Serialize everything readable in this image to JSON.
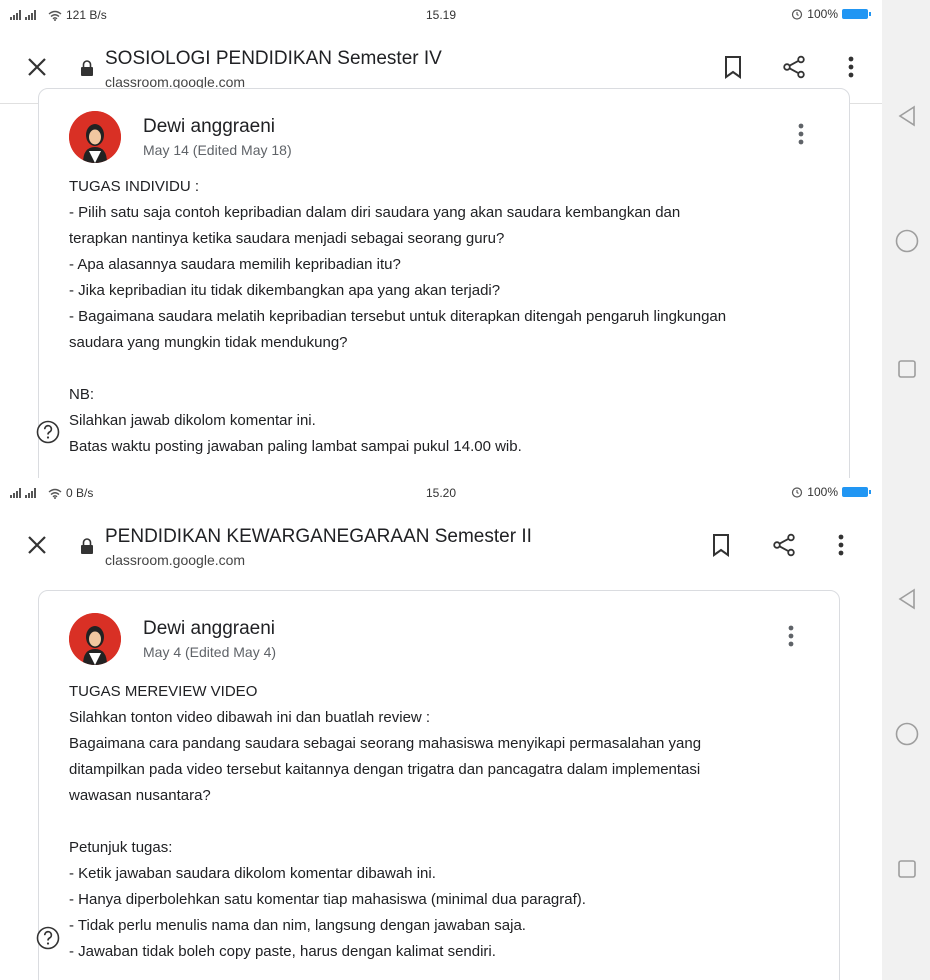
{
  "screens": [
    {
      "status": {
        "speed": "121 B/s",
        "time": "15.19",
        "battery": "100%"
      },
      "title": "SOSIOLOGI PENDIDIKAN Semester IV",
      "url": "classroom.google.com",
      "post": {
        "author": "Dewi anggraeni",
        "date": "May 14 (Edited May 18)",
        "lines": [
          "TUGAS INDIVIDU :",
          "- Pilih satu saja contoh kepribadian dalam diri saudara yang akan saudara kembangkan dan",
          "terapkan nantinya ketika saudara menjadi sebagai seorang guru?",
          "- Apa alasannya saudara memilih kepribadian itu?",
          "- Jika kepribadian itu tidak dikembangkan apa yang akan terjadi?",
          "- Bagaimana saudara melatih kepribadian tersebut untuk diterapkan ditengah pengaruh lingkungan",
          "saudara yang mungkin tidak mendukung?",
          "",
          "NB:",
          "Silahkan jawab dikolom komentar ini.",
          "Batas waktu posting jawaban paling lambat sampai pukul 14.00 wib."
        ]
      }
    },
    {
      "status": {
        "speed": "0 B/s",
        "time": "15.20",
        "battery": "100%"
      },
      "title": "PENDIDIKAN KEWARGANEGARAAN Semester II",
      "url": "classroom.google.com",
      "post": {
        "author": "Dewi anggraeni",
        "date": "May 4 (Edited May 4)",
        "lines": [
          "TUGAS MEREVIEW VIDEO",
          "Silahkan tonton video dibawah ini dan buatlah review :",
          "Bagaimana cara pandang saudara sebagai seorang mahasiswa menyikapi permasalahan yang",
          "ditampilkan pada video tersebut kaitannya dengan trigatra dan pancagatra dalam implementasi",
          "wawasan nusantara?",
          "",
          "Petunjuk tugas:",
          "- Ketik jawaban saudara dikolom komentar dibawah ini.",
          "- Hanya diperbolehkan satu komentar tiap mahasiswa (minimal dua paragraf).",
          "- Tidak perlu menulis nama dan nim, langsung dengan jawaban saja.",
          "- Jawaban tidak boleh copy paste, harus dengan kalimat sendiri."
        ]
      }
    }
  ],
  "icons": {
    "close": "close-icon",
    "lock": "lock-icon",
    "bookmark": "bookmark-icon",
    "share": "share-icon",
    "more": "more-vert-icon",
    "help": "help-circle-icon",
    "back": "nav-back-icon",
    "home": "nav-home-icon",
    "recents": "nav-recents-icon"
  },
  "colors": {
    "avatar": "#d93025",
    "battery": "#2196f3",
    "icon": "#333333"
  }
}
